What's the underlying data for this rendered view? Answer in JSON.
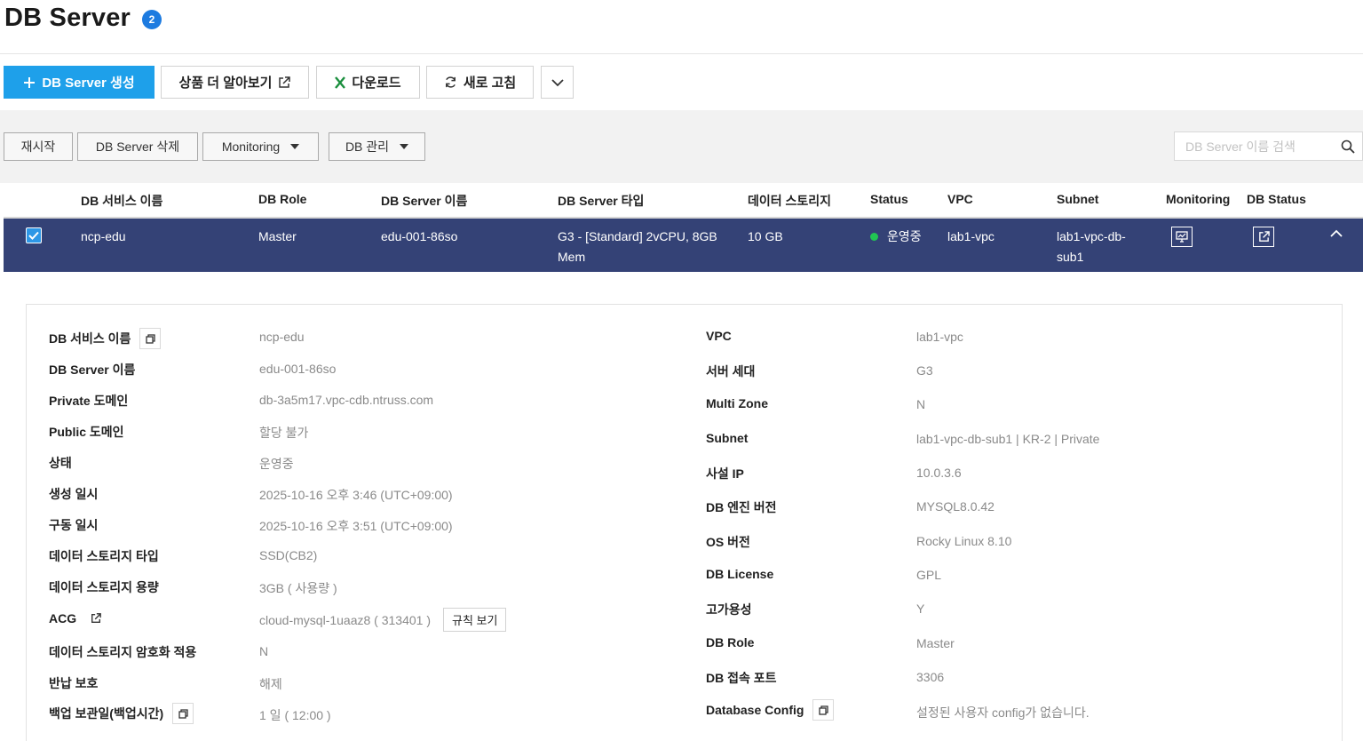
{
  "header": {
    "title": "DB Server",
    "count": "2"
  },
  "toolbar": {
    "create_label": "DB Server 생성",
    "learn_more_label": "상품 더 알아보기",
    "download_label": "다운로드",
    "refresh_label": "새로 고침"
  },
  "actions": {
    "restart": "재시작",
    "delete": "DB Server 삭제",
    "monitoring": "Monitoring",
    "db_manage": "DB 관리",
    "search_placeholder": "DB Server 이름 검색"
  },
  "table": {
    "headers": [
      "DB 서비스 이름",
      "DB Role",
      "DB Server 이름",
      "DB Server 타입",
      "데이터 스토리지",
      "Status",
      "VPC",
      "Subnet",
      "Monitoring",
      "DB Status"
    ],
    "row": {
      "service_name": "ncp-edu",
      "role": "Master",
      "server_name": "edu-001-86so",
      "server_type_line1": "G3 - [Standard] 2vCPU, 8GB",
      "server_type_line2": "Mem",
      "storage": "10 GB",
      "status": "운영중",
      "vpc": "lab1-vpc",
      "subnet_line1": "lab1-vpc-db-",
      "subnet_line2": "sub1"
    }
  },
  "detail": {
    "left": [
      {
        "label": "DB 서비스 이름",
        "value": "ncp-edu"
      },
      {
        "label": "DB Server 이름",
        "value": "edu-001-86so"
      },
      {
        "label": "Private 도메인",
        "value": "db-3a5m17.vpc-cdb.ntruss.com"
      },
      {
        "label": "Public 도메인",
        "value": "할당 불가"
      },
      {
        "label": "상태",
        "value": "운영중"
      },
      {
        "label": "생성 일시",
        "value": "2025-10-16 오후 3:46 (UTC+09:00)"
      },
      {
        "label": "구동 일시",
        "value": "2025-10-16 오후 3:51 (UTC+09:00)"
      },
      {
        "label": "데이터 스토리지 타입",
        "value": "SSD(CB2)"
      },
      {
        "label": "데이터 스토리지 용량",
        "value": "3GB ( 사용량 )"
      },
      {
        "label": "ACG",
        "value": "cloud-mysql-1uaaz8 ( 313401 )"
      },
      {
        "label": "데이터 스토리지 암호화 적용",
        "value": "N"
      },
      {
        "label": "반납 보호",
        "value": "해제"
      },
      {
        "label": "백업 보관일(백업시간)",
        "value": "1 일 ( 12:00 )"
      }
    ],
    "rule_button": "규칙 보기",
    "right": [
      {
        "label": "VPC",
        "value": "lab1-vpc"
      },
      {
        "label": "서버 세대",
        "value": "G3"
      },
      {
        "label": "Multi Zone",
        "value": "N"
      },
      {
        "label": "Subnet",
        "value": "lab1-vpc-db-sub1 | KR-2 | Private"
      },
      {
        "label": "사설 IP",
        "value": "10.0.3.6"
      },
      {
        "label": "DB 엔진 버전",
        "value": "MYSQL8.0.42"
      },
      {
        "label": "OS 버전",
        "value": "Rocky Linux 8.10"
      },
      {
        "label": "DB License",
        "value": "GPL"
      },
      {
        "label": "고가용성",
        "value": "Y"
      },
      {
        "label": "DB Role",
        "value": "Master"
      },
      {
        "label": "DB 접속 포트",
        "value": "3306"
      },
      {
        "label": "Database Config",
        "value": "설정된 사용자 config가 없습니다."
      }
    ]
  },
  "colors": {
    "primary": "#1ea0ea",
    "selected_row": "#344276",
    "status_running": "#21c653",
    "badge": "#1d7be0"
  }
}
